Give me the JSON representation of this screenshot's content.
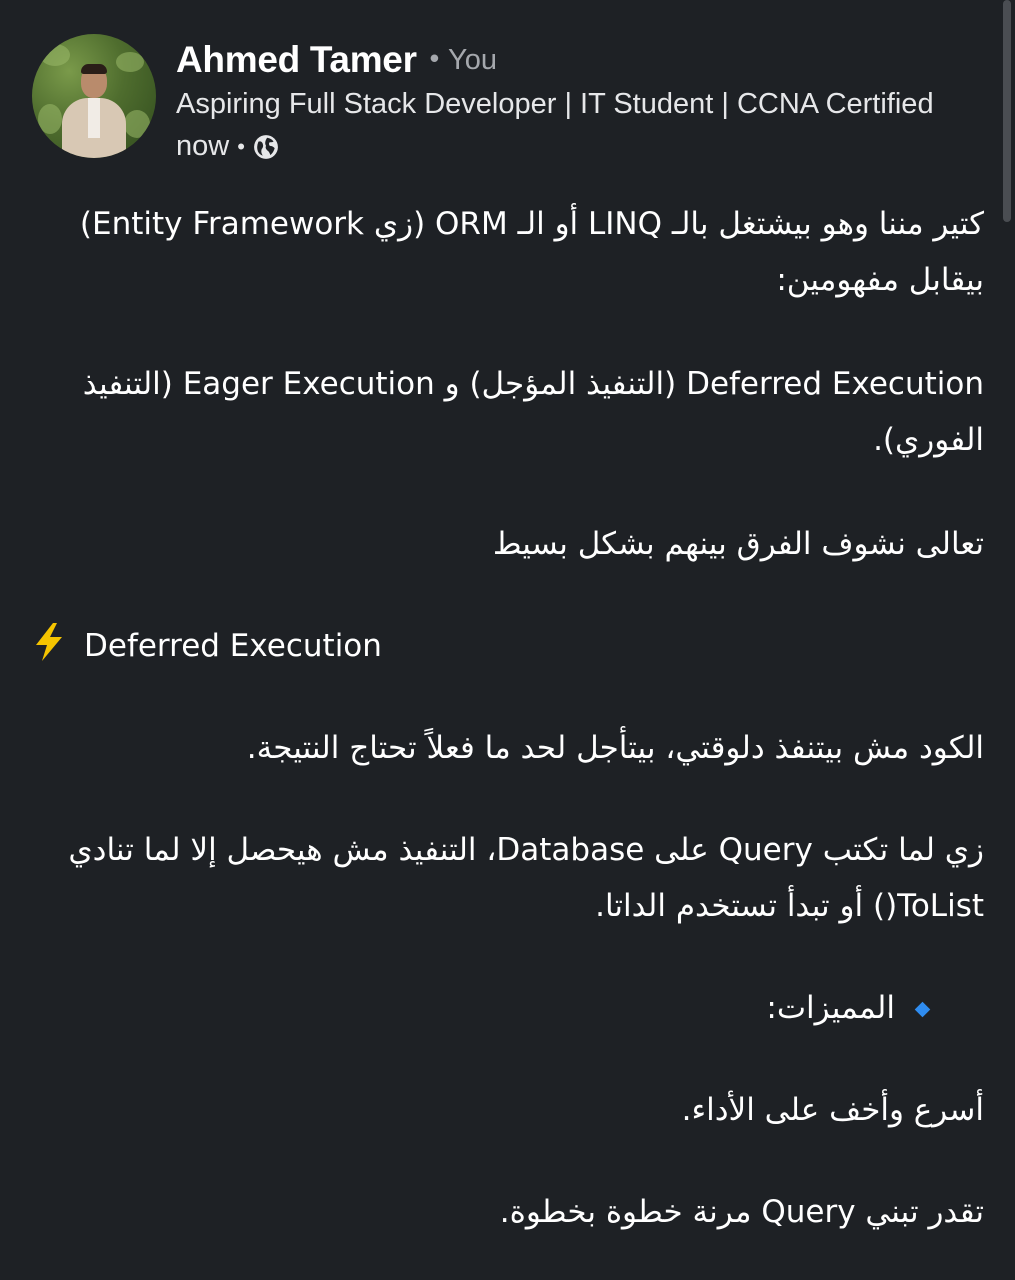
{
  "author": {
    "name": "Ahmed Tamer",
    "separator": "•",
    "relation": "You",
    "headline": "Aspiring Full Stack Developer | IT Student | CCNA Certified",
    "time": "now",
    "visibility_icon": "globe-icon"
  },
  "post": {
    "p1": "كتير مننا وهو بيشتغل بالـ LINQ أو الـ ORM (زي Entity Framework) بيقابل مفهومين:",
    "p2": "Deferred Execution (التنفيذ المؤجل) و Eager Execution (التنفيذ الفوري).",
    "p3": "تعالى نشوف الفرق بينهم بشكل بسيط",
    "section_title": "Deferred Execution",
    "section_icon": "lightning-bolt-icon",
    "p4": "الكود مش بيتنفذ دلوقتي، بيتأجل لحد ما فعلاً تحتاج النتيجة.",
    "p5": "زي لما تكتب Query على Database، التنفيذ مش هيحصل إلا لما تنادي ToList() أو تبدأ تستخدم الداتا.",
    "bullet_icon": "blue-diamond-icon",
    "bullet_title": "المميزات:",
    "p6": "أسرع وأخف على الأداء.",
    "p7": "تقدر تبني Query مرنة خطوة بخطوة."
  },
  "colors": {
    "background": "#1e2125",
    "text": "#ffffff",
    "muted": "#a5a8ad",
    "bullet": "#2f8cf0",
    "bolt": "#f5c400"
  }
}
